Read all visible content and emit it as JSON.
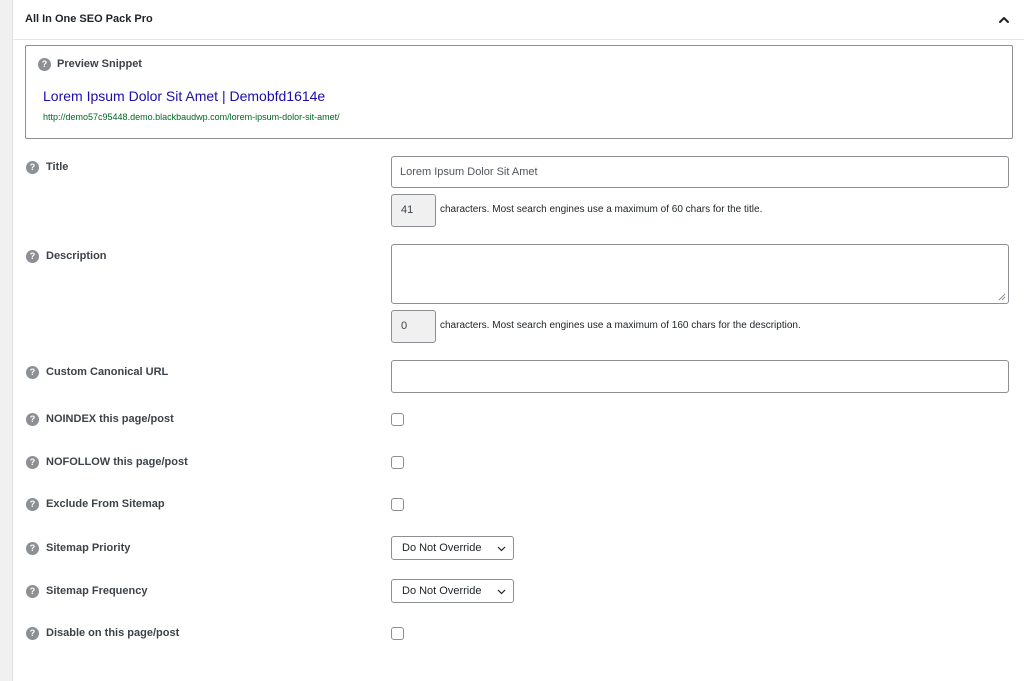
{
  "panel": {
    "title": "All In One SEO Pack Pro",
    "collapse_icon": "chevron-up-icon"
  },
  "help_icon": "question-mark-icon",
  "help_glyph": "?",
  "preview": {
    "label": "Preview Snippet",
    "title": "Lorem Ipsum Dolor Sit Amet | Demobfd1614e",
    "url": "http://demo57c95448.demo.blackbaudwp.com/lorem-ipsum-dolor-sit-amet/",
    "title_color": "#1a0dab",
    "url_color": "#006621"
  },
  "fields": {
    "title": {
      "label": "Title",
      "value": "Lorem Ipsum Dolor Sit Amet",
      "count": "41",
      "hint": "characters. Most search engines use a maximum of 60 chars for the title."
    },
    "description": {
      "label": "Description",
      "value": "",
      "count": "0",
      "hint": "characters. Most search engines use a maximum of 160 chars for the description."
    },
    "canonical": {
      "label": "Custom Canonical URL",
      "value": ""
    },
    "noindex": {
      "label": "NOINDEX this page/post",
      "checked": false
    },
    "nofollow": {
      "label": "NOFOLLOW this page/post",
      "checked": false
    },
    "exclude_sitemap": {
      "label": "Exclude From Sitemap",
      "checked": false
    },
    "sitemap_priority": {
      "label": "Sitemap Priority",
      "selected": "Do Not Override"
    },
    "sitemap_frequency": {
      "label": "Sitemap Frequency",
      "selected": "Do Not Override"
    },
    "disable": {
      "label": "Disable on this page/post",
      "checked": false
    }
  }
}
